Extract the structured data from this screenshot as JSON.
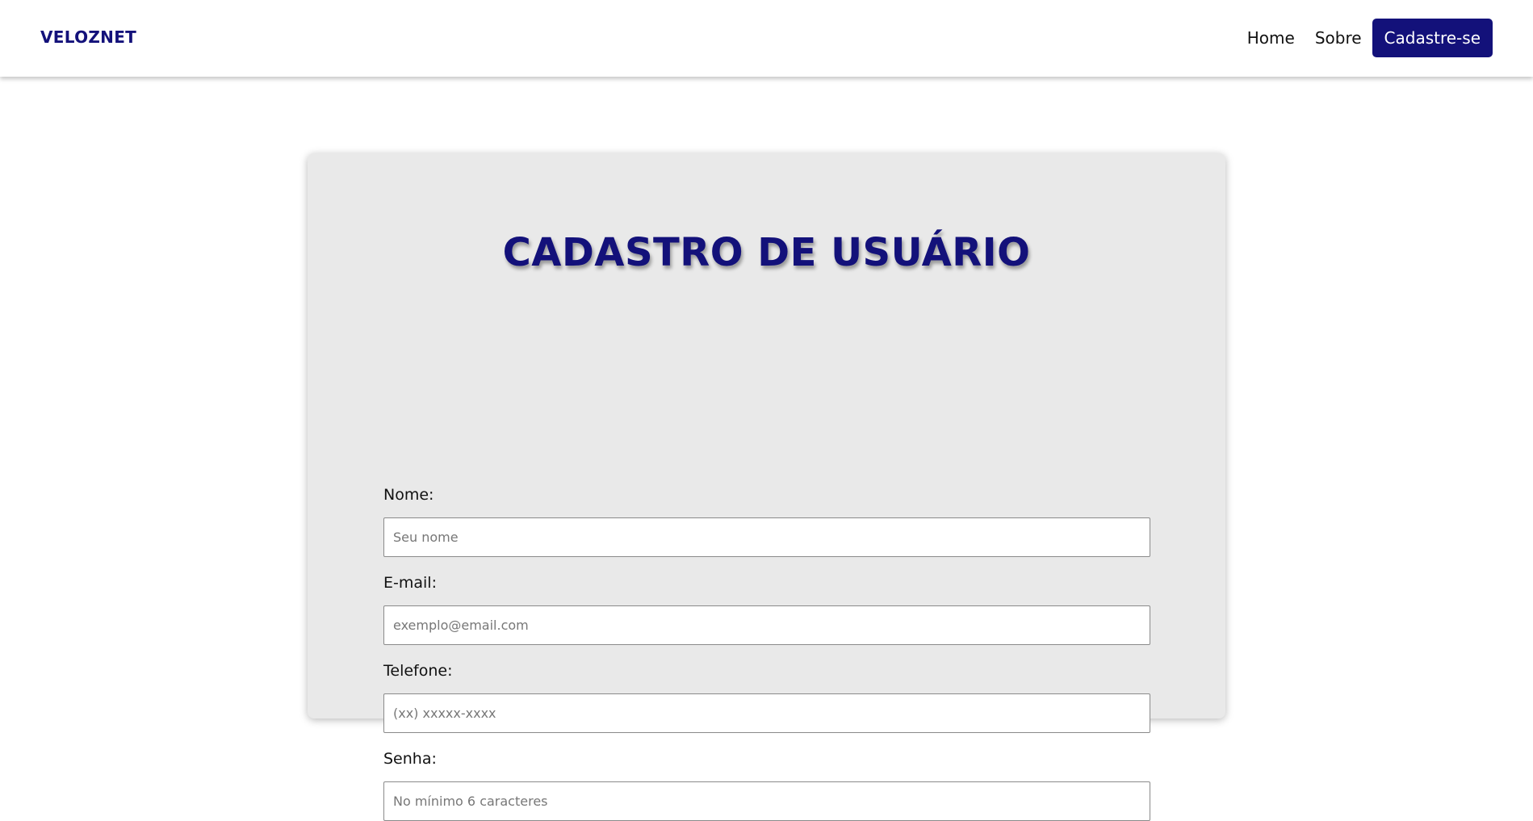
{
  "header": {
    "brand": "VELOZNET",
    "nav": {
      "home": "Home",
      "about": "Sobre",
      "signup": "Cadastre-se"
    }
  },
  "form": {
    "title": "CADASTRO DE USUÁRIO",
    "fields": [
      {
        "label": "Nome:",
        "placeholder": "Seu nome",
        "value": ""
      },
      {
        "label": "E-mail:",
        "placeholder": "exemplo@email.com",
        "value": ""
      },
      {
        "label": "Telefone:",
        "placeholder": "(xx) xxxxx-xxxx",
        "value": ""
      },
      {
        "label": "Senha:",
        "placeholder": "No mínimo 6 caracteres",
        "value": ""
      }
    ]
  },
  "colors": {
    "brand": "#13117a",
    "card_background": "#e9e9e9",
    "page_background": "#ffffff"
  }
}
